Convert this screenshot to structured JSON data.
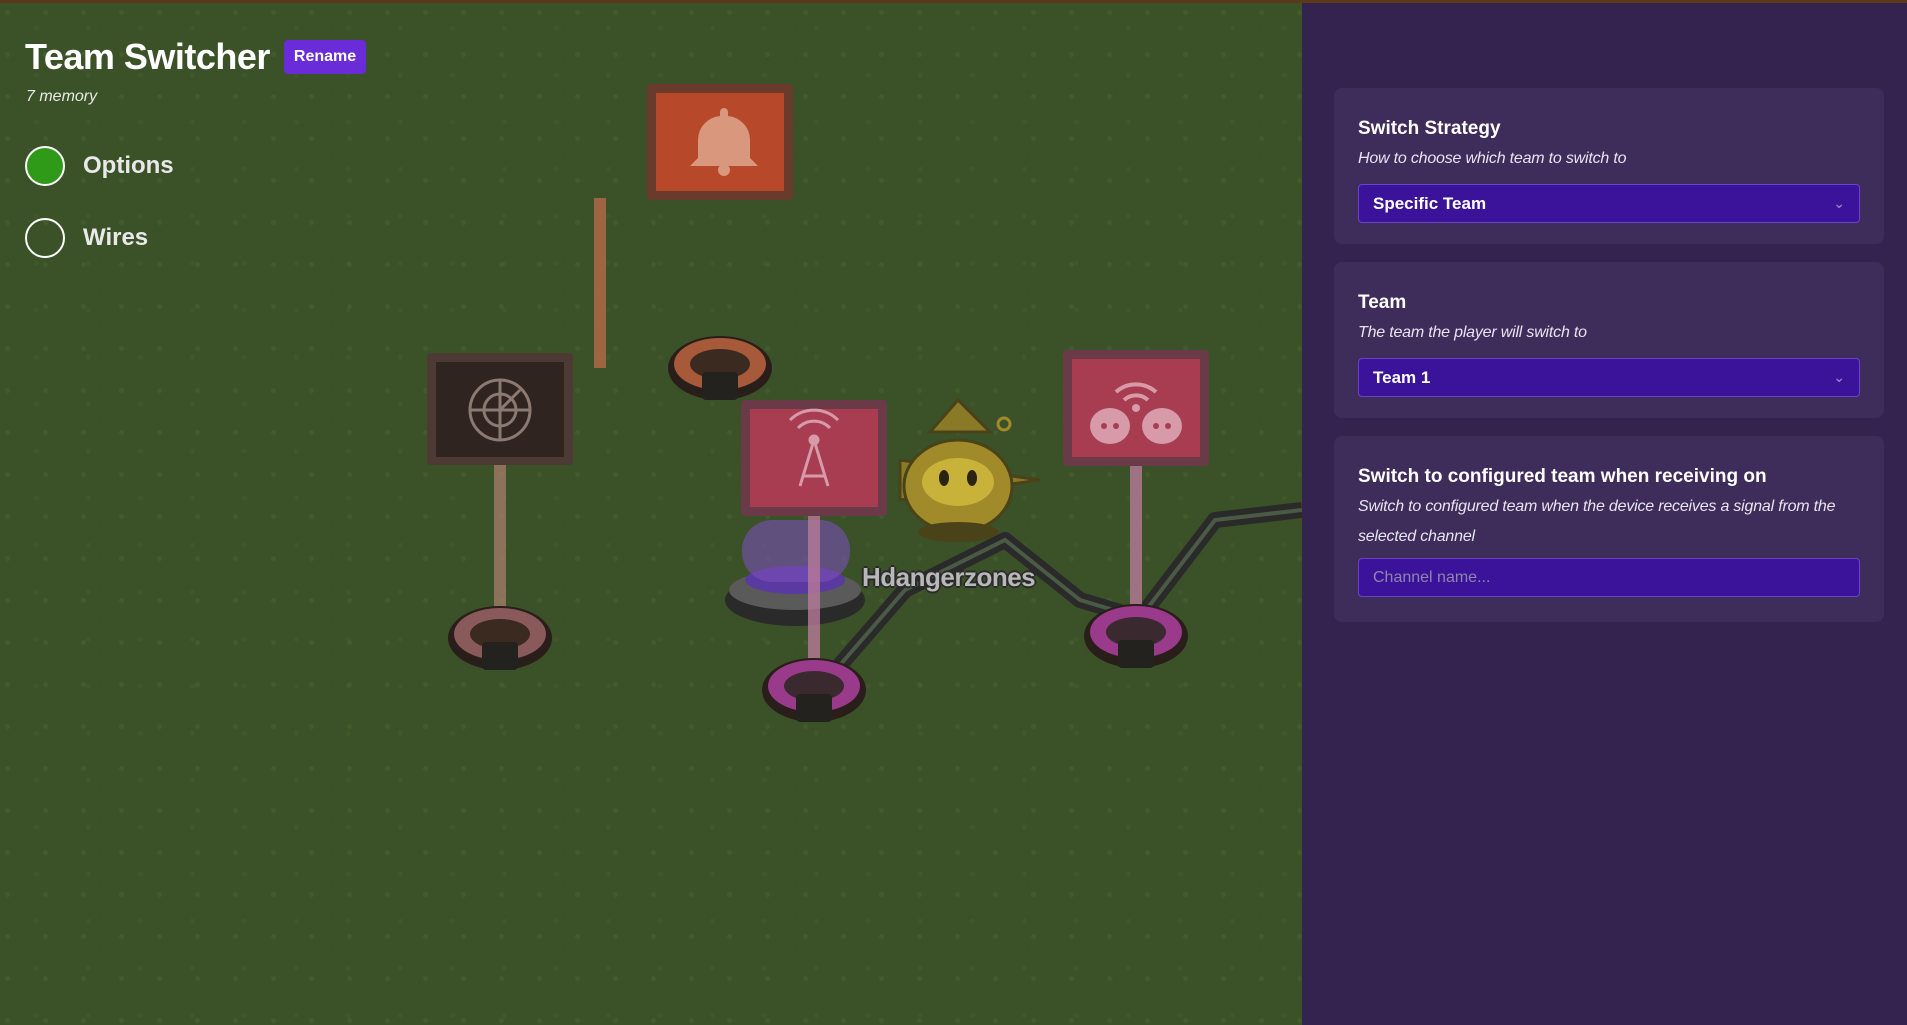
{
  "header": {
    "title": "Team Switcher",
    "rename_label": "Rename",
    "memory": "7 memory"
  },
  "tabs": [
    {
      "label": "Options",
      "active": true,
      "color": "#2f9a17"
    },
    {
      "label": "Wires",
      "active": false
    }
  ],
  "scene": {
    "player_name": "Hdangerzones",
    "devices": [
      {
        "icon": "bell-icon",
        "color": "#b8482a"
      },
      {
        "icon": "radar-icon",
        "color": "#4a3428"
      },
      {
        "icon": "broadcast-tower-icon",
        "color": "#a83d52"
      },
      {
        "icon": "wifi-players-icon",
        "color": "#a83d52"
      }
    ]
  },
  "panel": {
    "switch_strategy": {
      "title": "Switch Strategy",
      "description": "How to choose which team to switch to",
      "value": "Specific Team"
    },
    "team": {
      "title": "Team",
      "description": "The team the player will switch to",
      "value": "Team 1"
    },
    "channel": {
      "title": "Switch to configured team when receiving on",
      "description": "Switch to configured team when the device receives a signal from the selected channel",
      "placeholder": "Channel name..."
    }
  },
  "colors": {
    "panel_bg": "#35234f",
    "card_bg": "#3e2d5b",
    "select_bg": "#3a139a",
    "accent": "#6a2bd9"
  }
}
